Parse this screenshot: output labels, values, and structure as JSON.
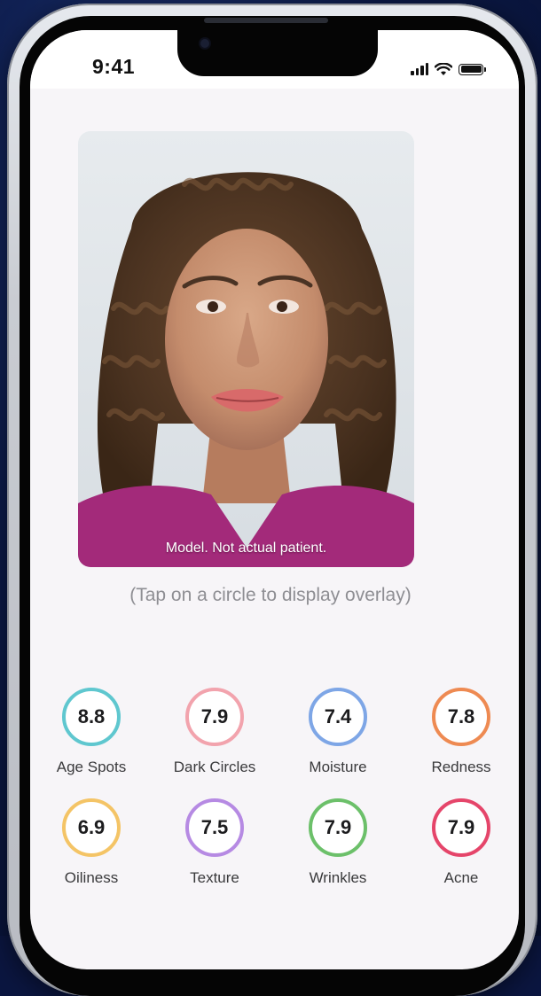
{
  "status_bar": {
    "time": "9:41"
  },
  "photo": {
    "caption": "Model. Not actual patient."
  },
  "hint": "(Tap on a circle to display overlay)",
  "metrics": [
    {
      "score": "8.8",
      "label": "Age Spots",
      "color": "#5fc7cf"
    },
    {
      "score": "7.9",
      "label": "Dark Circles",
      "color": "#f2a3ad"
    },
    {
      "score": "7.4",
      "label": "Moisture",
      "color": "#7ea6e6"
    },
    {
      "score": "7.8",
      "label": "Redness",
      "color": "#ee8a52"
    },
    {
      "score": "6.9",
      "label": "Oiliness",
      "color": "#f4c466"
    },
    {
      "score": "7.5",
      "label": "Texture",
      "color": "#b68ae3"
    },
    {
      "score": "7.9",
      "label": "Wrinkles",
      "color": "#6cc06a"
    },
    {
      "score": "7.9",
      "label": "Acne",
      "color": "#e5456a"
    }
  ]
}
